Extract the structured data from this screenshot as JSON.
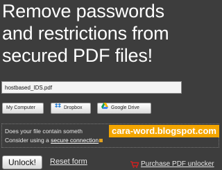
{
  "headline": {
    "line1": "Remove passwords",
    "line2": "and restrictions from",
    "line3": "secured PDF files!"
  },
  "file_input": {
    "value": "hostbased_IDS.pdf"
  },
  "sources": {
    "my_computer": "My Computer",
    "dropbox": "Dropbox",
    "google_drive": "Google Drive"
  },
  "notice": {
    "line1": "Does your file contain someth",
    "line2_prefix": "Consider using a ",
    "link": "secure connection"
  },
  "watermark": "cara-word.blogspot.com",
  "actions": {
    "unlock": "Unlock!",
    "reset": "Reset form",
    "purchase": "Purchase PDF unlocker"
  },
  "colors": {
    "background": "#3d3d3d",
    "watermark": "#f3a500",
    "cart_icon": "#d02020"
  }
}
